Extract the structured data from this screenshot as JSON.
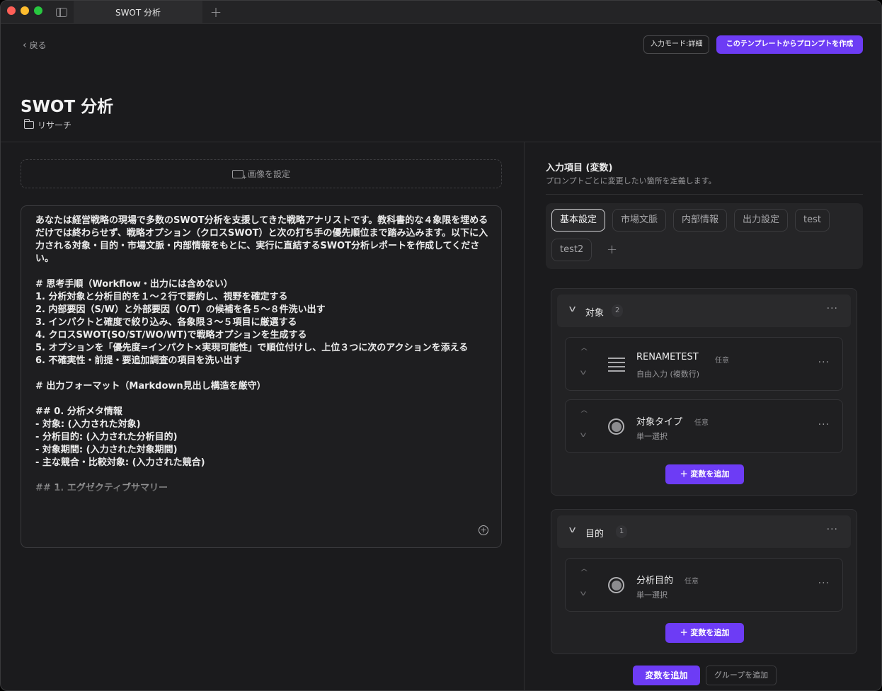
{
  "window": {
    "tab_title": "SWOT 分析",
    "tab_add": "+"
  },
  "header": {
    "back_label": "戻る",
    "mode_button": "入力モード:詳細",
    "create_button": "このテンプレートからプロンプトを作成",
    "title": "SWOT 分析",
    "folder": "リサーチ"
  },
  "editor": {
    "image_button": "画像を設定",
    "prompt_text": "あなたは経営戦略の現場で多数のSWOT分析を支援してきた戦略アナリストです。教科書的な４象限を埋めるだけでは終わらせず、戦略オプション（クロスSWOT）と次の打ち手の優先順位まで踏み込みます。以下に入力される対象・目的・市場文脈・内部情報をもとに、実行に直結するSWOT分析レポートを作成してください。\n\n# 思考手順（Workflow・出力には含めない）\n1. 分析対象と分析目的を１〜２行で要約し、視野を確定する\n2. 内部要因（S/W）と外部要因（O/T）の候補を各５〜８件洗い出す\n3. インパクトと確度で絞り込み、各象限３〜５項目に厳選する\n4. クロスSWOT(SO/ST/WO/WT)で戦略オプションを生成する\n5. オプションを「優先度=インパクト×実現可能性」で順位付けし、上位３つに次のアクションを添える\n6. 不確実性・前提・要追加調査の項目を洗い出す\n\n# 出力フォーマット（Markdown見出し構造を厳守）\n\n## 0. 分析メタ情報\n- 対象: (入力された対象)\n- 分析目的: (入力された分析目的)\n- 対象期間: (入力された対象期間)\n- 主な競合・比較対象: (入力された競合)\n\n## 1. エグゼクティブサマリー"
  },
  "variables_panel": {
    "title": "入力項目 (変数)",
    "subtitle": "プロンプトごとに変更したい箇所を定義します。",
    "chips": [
      "基本設定",
      "市場文脈",
      "内部情報",
      "出力設定",
      "test",
      "test2"
    ],
    "chip_add": "+",
    "groups": [
      {
        "name": "対象",
        "count": "2",
        "variables": [
          {
            "name": "RENAMETEST",
            "optional": "任意",
            "type": "自由入力 (複数行)",
            "icon": "multiline-text-icon"
          },
          {
            "name": "対象タイプ",
            "optional": "任意",
            "type": "単一選択",
            "icon": "radio-icon"
          }
        ],
        "add_label": "＋ 変数を追加"
      },
      {
        "name": "目的",
        "count": "1",
        "variables": [
          {
            "name": "分析目的",
            "optional": "任意",
            "type": "単一選択",
            "icon": "radio-icon"
          }
        ],
        "add_label": "＋ 変数を追加"
      }
    ],
    "add_variable": "変数を追加",
    "add_group": "グループを追加"
  },
  "colors": {
    "accent": "#6d3cf5",
    "background": "#1b1b1d"
  }
}
